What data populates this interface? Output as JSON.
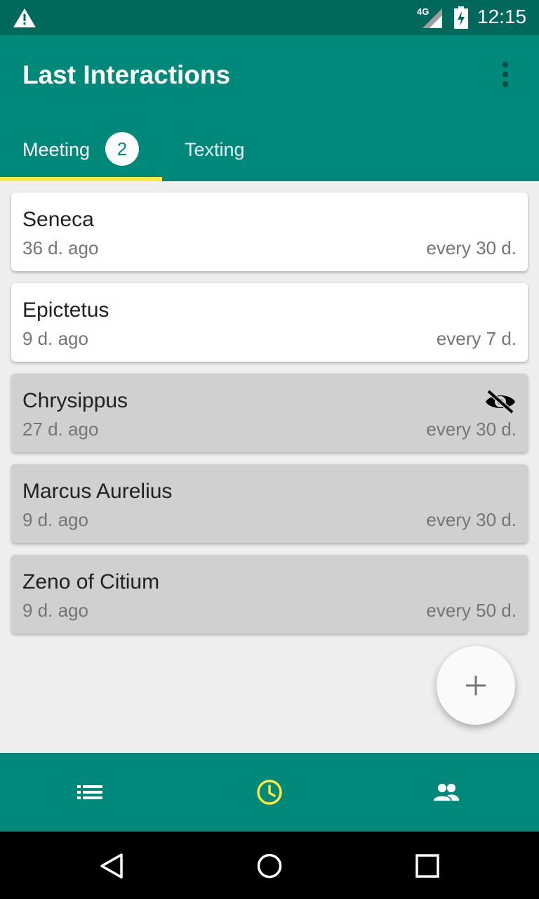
{
  "status_bar": {
    "network": "4G",
    "time": "12:15",
    "icons": [
      "warning-icon",
      "signal-icon",
      "battery-charging-icon"
    ]
  },
  "app_bar": {
    "title": "Last Interactions",
    "menu_icon": "more-vert-icon"
  },
  "tabs": [
    {
      "label": "Meeting",
      "badge": "2",
      "selected": true
    },
    {
      "label": "Texting",
      "selected": false
    }
  ],
  "contacts": [
    {
      "name": "Seneca",
      "last": "36 d. ago",
      "frequency": "every 30 d.",
      "hidden": false
    },
    {
      "name": "Epictetus",
      "last": "9 d. ago",
      "frequency": "every 7 d.",
      "hidden": false
    },
    {
      "name": "Chrysippus",
      "last": "27 d. ago",
      "frequency": "every 30 d.",
      "hidden": true
    },
    {
      "name": "Marcus Aurelius",
      "last": "9 d. ago",
      "frequency": "every 30 d.",
      "hidden": false
    },
    {
      "name": "Zeno of Citium",
      "last": "9 d. ago",
      "frequency": "every 50 d.",
      "hidden": false
    }
  ],
  "fab": {
    "icon": "add-icon"
  },
  "bottom_nav": [
    {
      "icon": "list-icon",
      "selected": false
    },
    {
      "icon": "clock-icon",
      "selected": true
    },
    {
      "icon": "people-icon",
      "selected": false
    }
  ],
  "system_nav": [
    "back-icon",
    "home-icon",
    "recents-icon"
  ],
  "colors": {
    "primary": "#00897b",
    "primary_dark": "#00695c",
    "accent": "#ffeb3b",
    "card_active": "#ffffff",
    "card_inactive": "#d0d0d0"
  }
}
